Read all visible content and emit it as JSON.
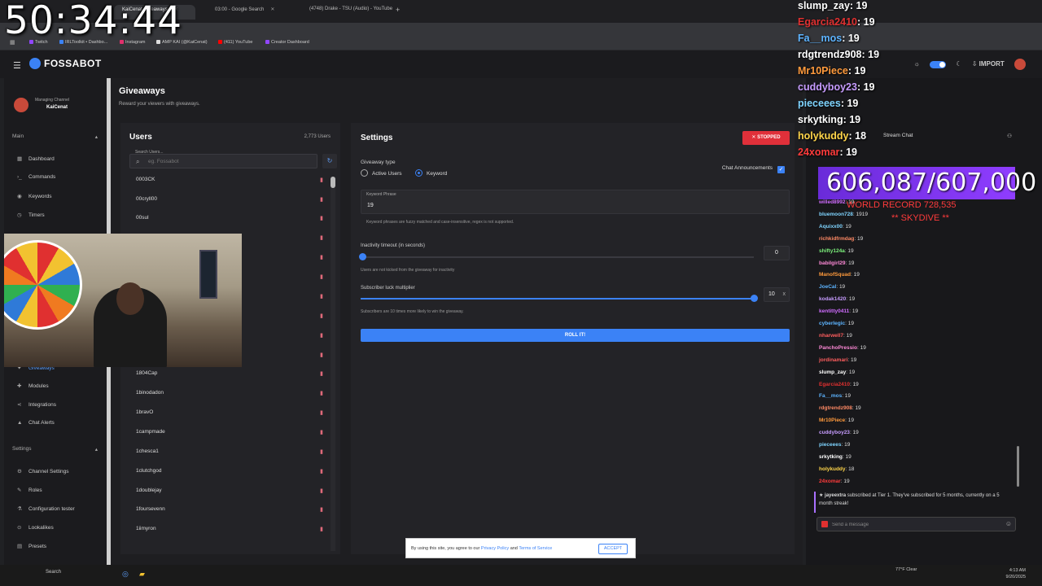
{
  "overlay": {
    "timer": "50:34:44",
    "record_count": "606,087/607,000",
    "record_label": "WORLD RECORD 728,535",
    "record_sub": "** SKYDIVE **"
  },
  "browser": {
    "tabs": [
      {
        "label": "KaiCenat Giveaways",
        "active": true
      },
      {
        "label": "03:00 - Google Search",
        "active": false
      },
      {
        "label": "(4748) Drake - TSU (Audio) - YouTube",
        "active": false
      }
    ],
    "bookmarks": [
      {
        "label": "Twitch",
        "color": "#9146ff"
      },
      {
        "label": "IRLToolkit • Dashbo...",
        "color": "#3b82f6"
      },
      {
        "label": "Instagram",
        "color": "#e1306c"
      },
      {
        "label": "AMP KAI (@KaiCenat)",
        "color": "#dddddd"
      },
      {
        "label": "(411) YouTube",
        "color": "#ff0000"
      },
      {
        "label": "Creator Dashboard",
        "color": "#9146ff"
      }
    ]
  },
  "app": {
    "brand": "FOSSABOT",
    "header_import": "IMPORT"
  },
  "sidebar": {
    "channel_label": "Managing Channel",
    "channel_name": "KaiCenat",
    "main_section": "Main",
    "settings_section": "Settings",
    "main_items": [
      {
        "label": "Dashboard",
        "icon": "grid-icon"
      },
      {
        "label": "Commands",
        "icon": "terminal-icon"
      },
      {
        "label": "Keywords",
        "icon": "globe-icon"
      },
      {
        "label": "Timers",
        "icon": "clock-icon"
      },
      {
        "label": "Giveaways",
        "icon": "gift-icon"
      },
      {
        "label": "Modules",
        "icon": "modules-icon"
      },
      {
        "label": "Integrations",
        "icon": "share-icon"
      },
      {
        "label": "Chat Alerts",
        "icon": "bell-icon"
      }
    ],
    "settings_items": [
      {
        "label": "Channel Settings",
        "icon": "gear-icon"
      },
      {
        "label": "Roles",
        "icon": "roles-icon"
      },
      {
        "label": "Configuration tester",
        "icon": "tester-icon"
      },
      {
        "label": "Lookalikes",
        "icon": "lookalike-icon"
      },
      {
        "label": "Presets",
        "icon": "presets-icon"
      }
    ]
  },
  "page": {
    "title": "Giveaways",
    "subtitle": "Reward your viewers with giveaways."
  },
  "users": {
    "title": "Users",
    "count": "2,773 Users",
    "search_label": "Search Users...",
    "search_placeholder": "eg. Fossabot",
    "rows": [
      "0003CK",
      "00cryll00",
      "00sul",
      "1804Cap",
      "1binodadon",
      "1bravO",
      "1campmade",
      "1chesca1",
      "1clutchgod",
      "1doublejay",
      "1foursevenn",
      "1iimyron"
    ]
  },
  "settings": {
    "title": "Settings",
    "stopped_label": "STOPPED",
    "giveaway_type_label": "Giveaway type",
    "radio_active_users": "Active Users",
    "radio_keyword": "Keyword",
    "chat_announcements": "Chat Announcements",
    "keyword_label": "Keyword Phrase",
    "keyword_value": "19",
    "keyword_help": "Keyword phrases are fuzzy matched and case-insensitive, regex is not supported.",
    "inactivity_label": "Inactivity timeout (in seconds)",
    "inactivity_value": "0",
    "inactivity_level": 0,
    "inactivity_help": "Users are not kicked from the giveaway for inactivity",
    "luck_label": "Subscriber luck multiplier",
    "luck_value": "10",
    "luck_x": "x",
    "luck_level": 1.0,
    "luck_help": "Subscribers are 10 times more likely to win the giveaway.",
    "roll_button": "ROLL IT!"
  },
  "cookie": {
    "text_prefix": "By using this site, you agree to our",
    "privacy": "Privacy Policy",
    "and": "and",
    "terms": "Terms of Service",
    "accept": "ACCEPT"
  },
  "chat": {
    "header": "Stream Chat",
    "big_lines": [
      {
        "name": "slump_zay",
        "msg": ": 19",
        "color": "#ffffff"
      },
      {
        "name": "Egarcia2410",
        "msg": ": 19",
        "color": "#e03030"
      },
      {
        "name": "Fa__mos",
        "msg": ": 19",
        "color": "#5db4ff"
      },
      {
        "name": "rdgtrendz908",
        "msg": ": 19",
        "color": "#ffffff"
      },
      {
        "name": "Mr10Piece",
        "msg": ": 19",
        "color": "#ff9a3c"
      },
      {
        "name": "cuddyboy23",
        "msg": ": 19",
        "color": "#c79cff"
      },
      {
        "name": "pieceees",
        "msg": ": 19",
        "color": "#7fd4ff"
      },
      {
        "name": "srkytking",
        "msg": ": 19",
        "color": "#ffffff"
      },
      {
        "name": "holykuddy",
        "msg": ": 18",
        "color": "#ffd54a"
      },
      {
        "name": "24xomar",
        "msg": ": 19",
        "color": "#ff3b3b"
      }
    ],
    "lines": [
      {
        "name": "willed8992",
        "msg": ": 19",
        "color": "#d06cff"
      },
      {
        "name": "bluemoon728",
        "msg": ": 1919",
        "color": "#7fd4ff"
      },
      {
        "name": "Aquixx00",
        "msg": ": 19",
        "color": "#7fd4ff"
      },
      {
        "name": "richkidfrmdag",
        "msg": ": 19",
        "color": "#ff8a65"
      },
      {
        "name": "shifty124a",
        "msg": ": 19",
        "color": "#7cf27c"
      },
      {
        "name": "babilgirl29",
        "msg": ": 19",
        "color": "#ff8ad8"
      },
      {
        "name": "ManofSquad",
        "msg": ": 19",
        "color": "#ff9a3c"
      },
      {
        "name": "JoeCal",
        "msg": ": 19",
        "color": "#5db4ff"
      },
      {
        "name": "kodak1420",
        "msg": ": 19",
        "color": "#c79cff"
      },
      {
        "name": "kentitty0411",
        "msg": ": 19",
        "color": "#d06cff"
      },
      {
        "name": "cyberlegic",
        "msg": ": 19",
        "color": "#5db4ff"
      },
      {
        "name": "nharwell7",
        "msg": ": 19",
        "color": "#ff5e5e"
      },
      {
        "name": "PanchoPressio",
        "msg": ": 19",
        "color": "#ff8ad8"
      },
      {
        "name": "jordinamari",
        "msg": ": 19",
        "color": "#ff5e5e"
      },
      {
        "name": "slump_zay",
        "msg": ": 19",
        "color": "#ffffff"
      },
      {
        "name": "Egarcia2410",
        "msg": ": 19",
        "color": "#e03030"
      },
      {
        "name": "Fa__mos",
        "msg": ": 19",
        "color": "#5db4ff"
      },
      {
        "name": "rdgtrendz908",
        "msg": ": 19",
        "color": "#ff8a65"
      },
      {
        "name": "Mr10Piece",
        "msg": ": 19",
        "color": "#ff9a3c"
      },
      {
        "name": "cuddyboy23",
        "msg": ": 19",
        "color": "#c79cff"
      },
      {
        "name": "pieceees",
        "msg": ": 19",
        "color": "#7fd4ff"
      },
      {
        "name": "srkytking",
        "msg": ": 19",
        "color": "#ffffff"
      },
      {
        "name": "holykuddy",
        "msg": ": 18",
        "color": "#ffd54a"
      },
      {
        "name": "24xomar",
        "msg": ": 19",
        "color": "#ff3b3b"
      }
    ],
    "sub_notice_name": "jayeextra",
    "sub_notice_text": "subscribed at Tier 1. They've subscribed for 5 months, currently on a 5 month streak!",
    "send_placeholder": "Send a message"
  },
  "taskbar": {
    "search": "Search",
    "weather": "77°F Clear",
    "time": "4:13 AM",
    "date": "9/20/2025"
  }
}
